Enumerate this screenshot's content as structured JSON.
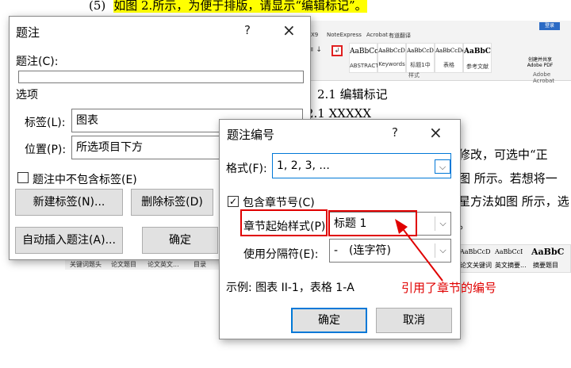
{
  "instruction": {
    "number": "(5)",
    "text": "如图 2.所示，为便于排版，请显示“编辑标记”。"
  },
  "word_bg": {
    "ribbon_tabs": [
      "X9",
      "NoteExpress",
      "Acrobat",
      "有道翻译"
    ],
    "styles": [
      {
        "preview": "AaBbCc",
        "name": "ABSTRACT"
      },
      {
        "preview": "AaBbCcD",
        "name": "Keywords"
      },
      {
        "preview": "AaBbCcD",
        "name": "标题1中"
      },
      {
        "preview": "AaBbCcDe",
        "name": "表格"
      },
      {
        "preview": "AaBbC",
        "name": "参考文献"
      }
    ],
    "group_label_styles": "样式",
    "group_label_acrobat": "Adobe Acrobat",
    "login": "登录",
    "acrobat_item": "创建并共享 Adobe PDF",
    "heading1": "2.1  编辑标记",
    "heading2": "2.1 XXXXX",
    "body_lines": [
      "修改，可选中“正",
      "图 所示。若想将一",
      "星方法如图 所示，选",
      "。"
    ],
    "stylebar_left": [
      "关键词题头",
      "论文题目",
      "论文英文...",
      "目录"
    ],
    "stylebar_right_previews": [
      "AaBbCcD",
      "AaBbCcI",
      "AaBbC"
    ],
    "stylebar_right_names": [
      "论文关键词",
      "英文摘要...",
      "摘要题目"
    ]
  },
  "caption_dialog": {
    "title": "题注",
    "help": "?",
    "close": "×",
    "caption_label": "题注(C):",
    "caption_value": "",
    "options_label": "选项",
    "label_label": "标签(L):",
    "label_value": "图表",
    "position_label": "位置(P):",
    "position_value": "所选项目下方",
    "exclude_label": "题注中不包含标签(E)",
    "new_label_button": "新建标签(N)...",
    "delete_label_button": "删除标签(D)",
    "auto_caption_button": "自动插入题注(A)...",
    "ok_button": "确定"
  },
  "numbering_dialog": {
    "title": "题注编号",
    "help": "?",
    "close": "×",
    "format_label": "格式(F):",
    "format_value": "1, 2, 3, ...",
    "include_chapter_label": "包含章节号(C)",
    "chapter_style_label": "章节起始样式(P)",
    "chapter_style_value": "标题 1",
    "separator_label": "使用分隔符(E):",
    "separator_value": "-　(连字符)",
    "example": "示例:  图表 II-1，表格 1-A",
    "ok_button": "确定",
    "cancel_button": "取消"
  },
  "annotation": "引用了章节的编号",
  "colors": {
    "highlight": "#ffff00",
    "annotation": "#e00000",
    "accent": "#0078d7"
  }
}
